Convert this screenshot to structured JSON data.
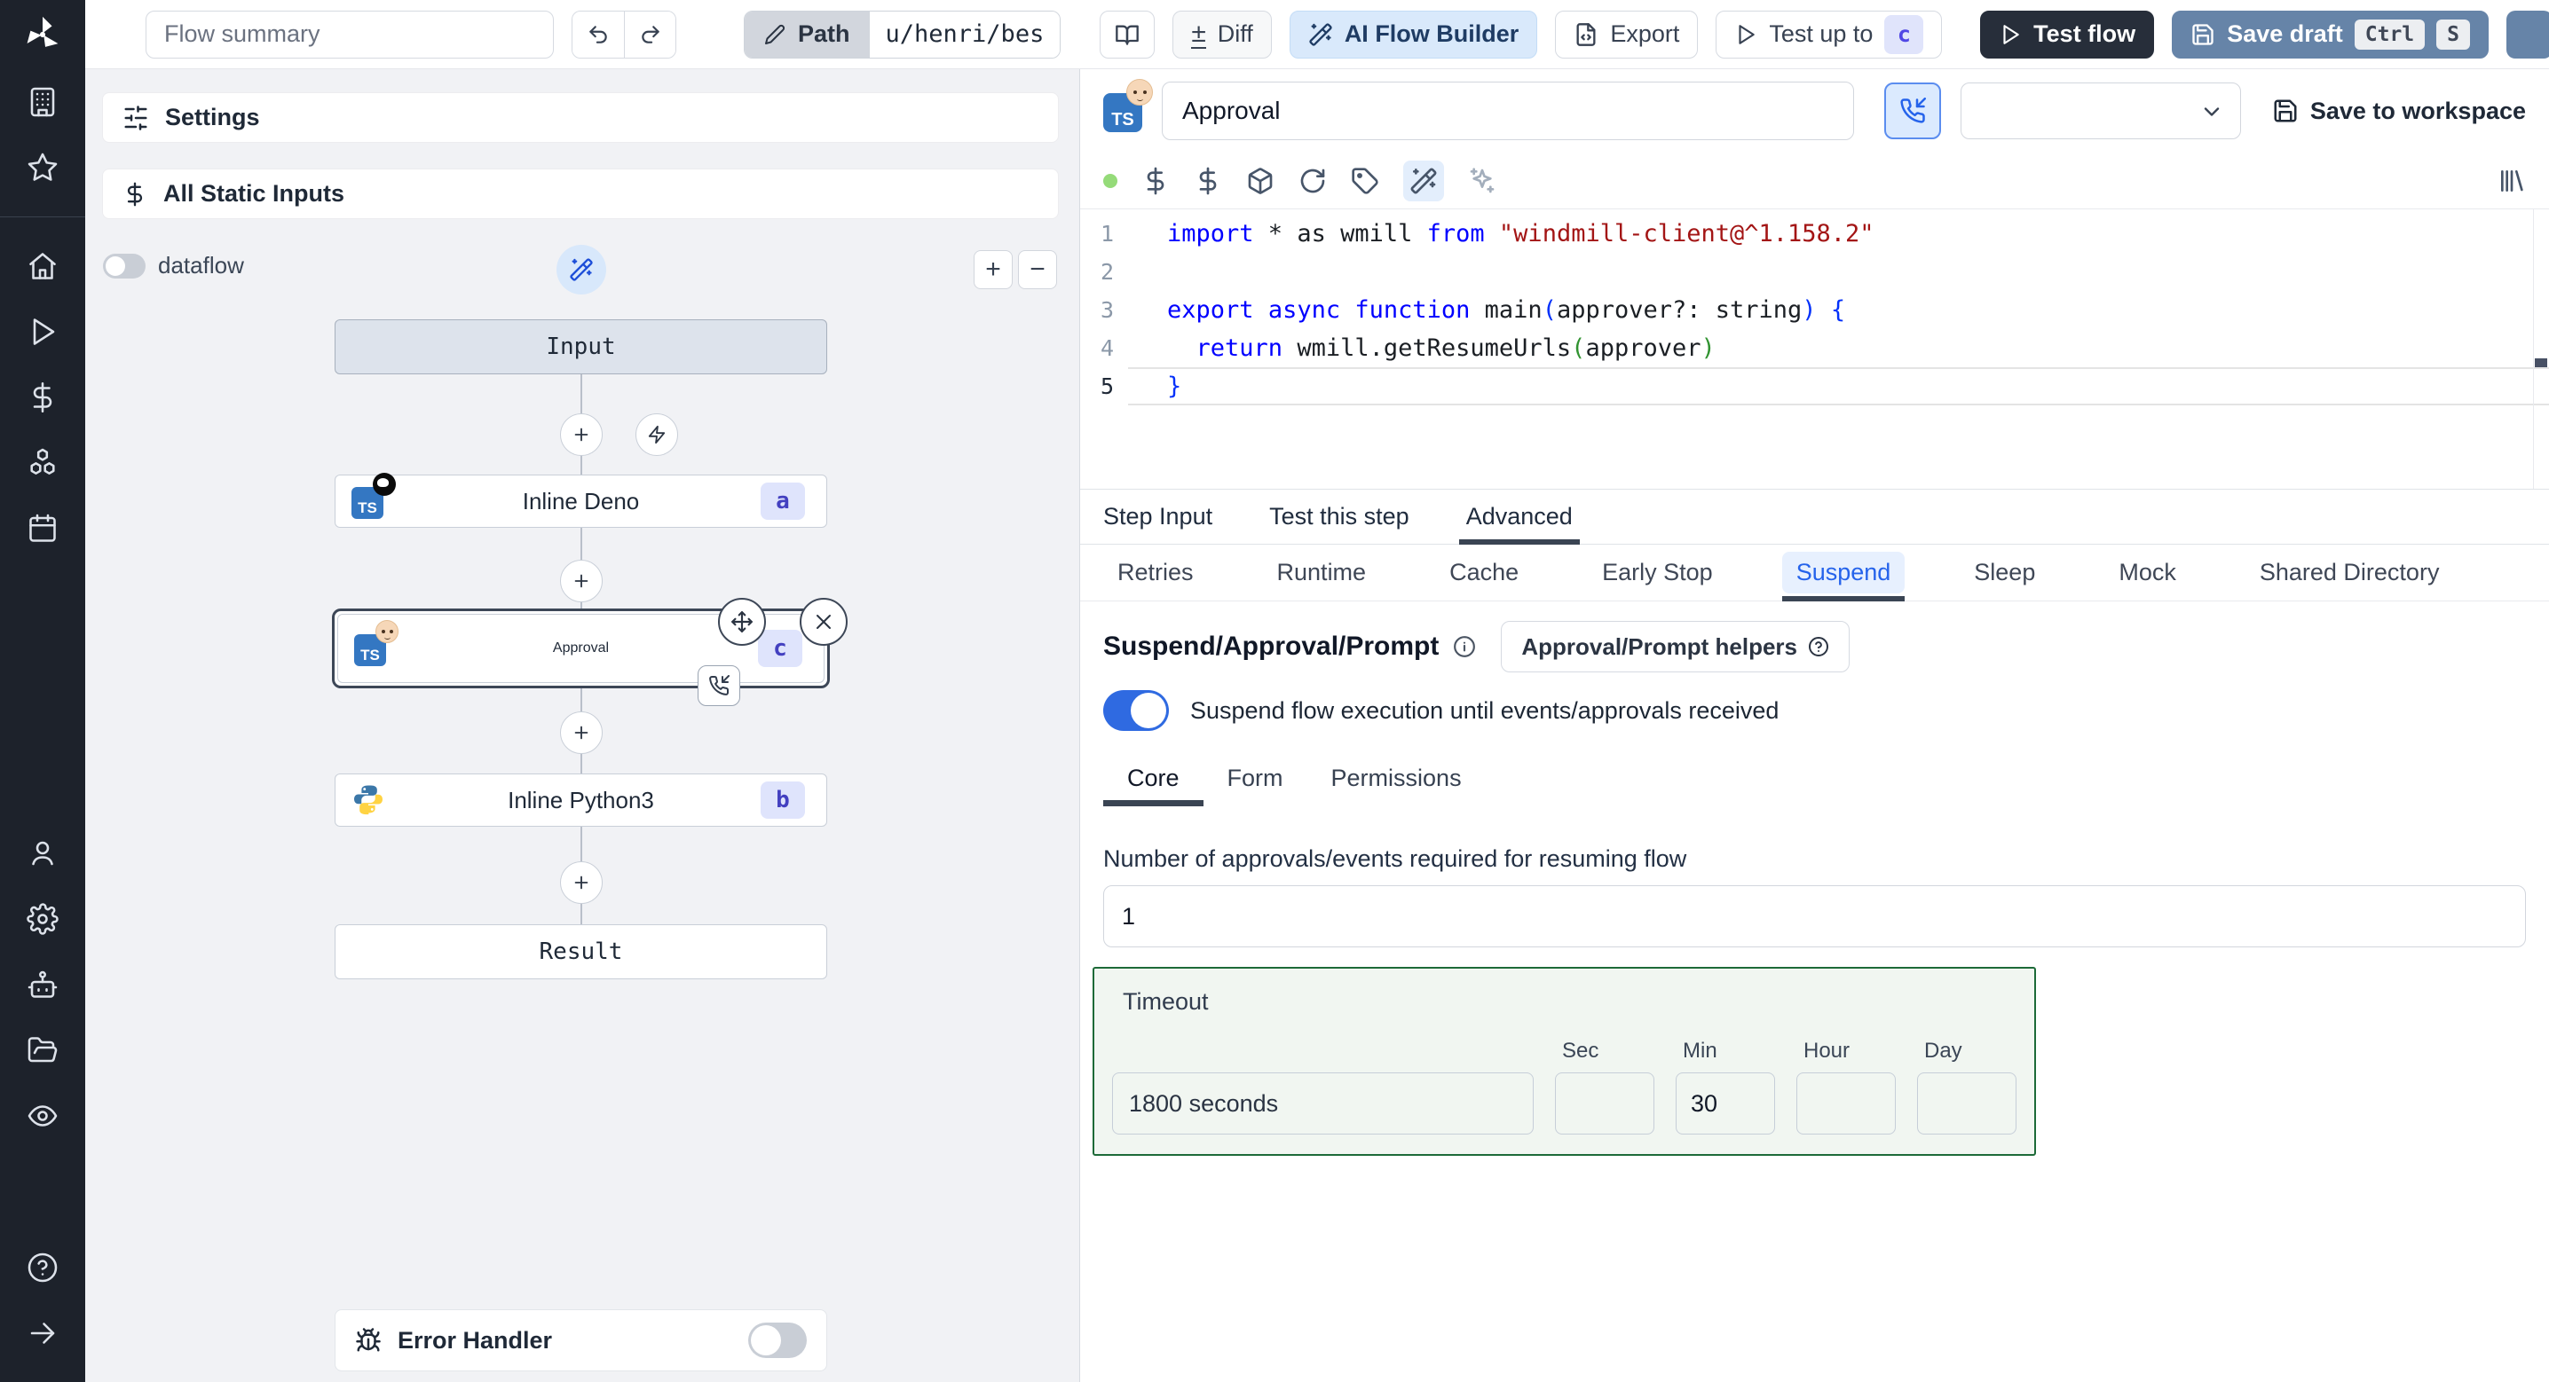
{
  "topbar": {
    "flow_summary_placeholder": "Flow summary",
    "path_label": "Path",
    "path_value": "u/henri/bes",
    "diff_label": "Diff",
    "ai_builder_label": "AI Flow Builder",
    "export_label": "Export",
    "test_up_to_label": "Test up to",
    "test_up_to_badge": "c",
    "test_flow_label": "Test flow",
    "save_draft_label": "Save draft",
    "shortcut_ctrl": "Ctrl",
    "shortcut_s": "S"
  },
  "sidebar": {
    "icons": [
      "windmill-logo",
      "building",
      "star",
      "home",
      "play",
      "dollar",
      "boxes",
      "calendar",
      "user",
      "settings",
      "bot",
      "folder-open",
      "eye",
      "help",
      "arrow-right"
    ]
  },
  "flow_panel": {
    "settings_label": "Settings",
    "all_static_inputs_label": "All Static Inputs",
    "dataflow_label": "dataflow",
    "zoom_in_label": "+",
    "zoom_out_label": "−",
    "error_handler_label": "Error Handler",
    "nodes": {
      "input_label": "Input",
      "deno_label": "Inline Deno",
      "deno_badge": "a",
      "approval_label": "Approval",
      "approval_badge": "c",
      "python_label": "Inline Python3",
      "python_badge": "b",
      "result_label": "Result"
    }
  },
  "step": {
    "name_value": "Approval",
    "save_to_workspace_label": "Save to workspace",
    "toolbar_icons": [
      "status-dot",
      "dollar",
      "dollar",
      "package",
      "rotate",
      "tag",
      "wand-active",
      "sparkles",
      "library"
    ],
    "tabs": [
      "Step Input",
      "Test this step",
      "Advanced"
    ],
    "active_tab": "Advanced",
    "subtabs": [
      "Retries",
      "Runtime",
      "Cache",
      "Early Stop",
      "Suspend",
      "Sleep",
      "Mock",
      "Shared Directory"
    ],
    "active_subtab": "Suspend",
    "code": {
      "lines": [
        {
          "n": "1",
          "current": false,
          "tokens": [
            {
              "c": "kw",
              "t": "import"
            },
            {
              "c": "pl",
              "t": " * as wmill "
            },
            {
              "c": "kw",
              "t": "from"
            },
            {
              "c": "pl",
              "t": " "
            },
            {
              "c": "str",
              "t": "\"windmill-client@^1.158.2\""
            }
          ]
        },
        {
          "n": "2",
          "current": false,
          "tokens": []
        },
        {
          "n": "3",
          "current": false,
          "tokens": [
            {
              "c": "kw",
              "t": "export"
            },
            {
              "c": "pl",
              "t": " "
            },
            {
              "c": "kw",
              "t": "async"
            },
            {
              "c": "pl",
              "t": " "
            },
            {
              "c": "kw",
              "t": "function"
            },
            {
              "c": "pl",
              "t": " main"
            },
            {
              "c": "br1",
              "t": "("
            },
            {
              "c": "pl",
              "t": "approver?: string"
            },
            {
              "c": "br1",
              "t": ")"
            },
            {
              "c": "pl",
              "t": " "
            },
            {
              "c": "br1",
              "t": "{"
            }
          ]
        },
        {
          "n": "4",
          "current": false,
          "tokens": [
            {
              "c": "pl",
              "t": "  "
            },
            {
              "c": "kw",
              "t": "return"
            },
            {
              "c": "pl",
              "t": " wmill.getResumeUrls"
            },
            {
              "c": "br2",
              "t": "("
            },
            {
              "c": "pl",
              "t": "approver"
            },
            {
              "c": "br2",
              "t": ")"
            }
          ]
        },
        {
          "n": "5",
          "current": true,
          "tokens": [
            {
              "c": "br1",
              "t": "}"
            }
          ]
        }
      ]
    }
  },
  "suspend": {
    "title": "Suspend/Approval/Prompt",
    "helpers_button_label": "Approval/Prompt helpers",
    "toggle_label": "Suspend flow execution until events/approvals received",
    "tabs": [
      "Core",
      "Form",
      "Permissions"
    ],
    "active_tab": "Core",
    "approvals_label": "Number of approvals/events required for resuming flow",
    "approvals_value": "1",
    "timeout": {
      "label": "Timeout",
      "display_value": "1800 seconds",
      "unit_labels": [
        "Sec",
        "Min",
        "Hour",
        "Day"
      ],
      "min_value": "30"
    }
  },
  "colors": {
    "accent_blue": "#2f6ae1",
    "badge_bg": "#dfe4fc",
    "badge_text": "#4340c0",
    "timeout_border": "#1d6a38",
    "ts_badge_blue": "#3477c2",
    "code_keyword": "#0000ff",
    "code_string": "#a31515",
    "sidebar_bg": "#1d222b",
    "test_flow_bg": "#272e3a",
    "save_draft_bg": "#6684a8",
    "status_green": "#95db79"
  }
}
